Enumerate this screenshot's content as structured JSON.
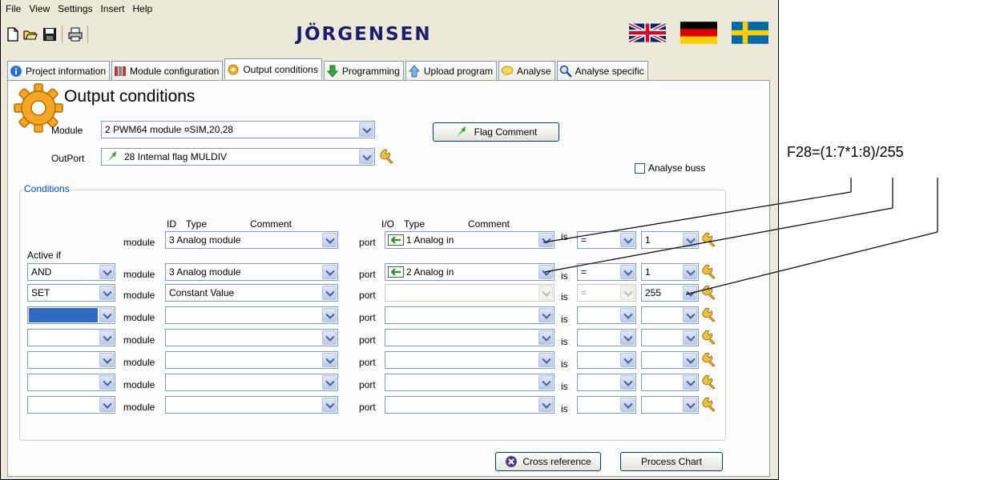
{
  "menu": {
    "file": "File",
    "view": "View",
    "settings": "Settings",
    "insert": "Insert",
    "help": "Help"
  },
  "brand": "JÖRGENSEN",
  "toolbar_icons": [
    "new-file-icon",
    "open-folder-icon",
    "save-icon",
    "print-icon"
  ],
  "flags": [
    "uk-flag-icon",
    "german-flag-icon",
    "swedish-flag-icon"
  ],
  "tabs": [
    {
      "label": "Project information",
      "icon": "info-icon"
    },
    {
      "label": "Module configuration",
      "icon": "modules-icon"
    },
    {
      "label": "Output conditions",
      "icon": "gear-icon",
      "active": true
    },
    {
      "label": "Programming",
      "icon": "green-arrow-icon"
    },
    {
      "label": "Upload program",
      "icon": "upload-arrow-icon"
    },
    {
      "label": "Analyse",
      "icon": "speech-bubble-icon"
    },
    {
      "label": "Analyse specific",
      "icon": "magnifier-icon"
    }
  ],
  "page": {
    "title": "Output conditions",
    "module_label": "Module",
    "module_value": "2 PWM64 module  ¤SIM,20,28",
    "outport_label": "OutPort",
    "outport_value": "28 Internal flag MULDIV",
    "flag_comment_button": "Flag Comment",
    "analyse_buss": "Analyse buss",
    "conditions_label": "Conditions"
  },
  "headers": {
    "id": "ID",
    "type": "Type",
    "comment": "Comment",
    "io": "I/O",
    "io_type": "Type",
    "io_comment": "Comment",
    "active_if": "Active if"
  },
  "row_words": {
    "module": "module",
    "port": "port",
    "is": "is"
  },
  "rows": [
    {
      "active": "",
      "module": "3 Analog module",
      "port": "1  Analog in",
      "op": "=",
      "value": "1"
    },
    {
      "active": "AND",
      "module": "3 Analog module",
      "port": "2  Analog in",
      "op": "=",
      "value": "1"
    },
    {
      "active": "SET",
      "module": "Constant Value",
      "port": "",
      "op": "=",
      "value": "255"
    },
    {
      "active": "",
      "module": "",
      "port": "",
      "op": "",
      "value": ""
    },
    {
      "active": "",
      "module": "",
      "port": "",
      "op": "",
      "value": ""
    },
    {
      "active": "",
      "module": "",
      "port": "",
      "op": "",
      "value": ""
    },
    {
      "active": "",
      "module": "",
      "port": "",
      "op": "",
      "value": ""
    },
    {
      "active": "",
      "module": "",
      "port": "",
      "op": "",
      "value": ""
    }
  ],
  "footer": {
    "cross_reference": "Cross reference",
    "process_chart": "Process Chart"
  },
  "annotation": "F28=(1:7*1:8)/255",
  "colors": {
    "window_bg": "#ece9d8",
    "brand": "#1a1e6e",
    "selection": "#316ac5",
    "group_label": "#0046d5"
  }
}
